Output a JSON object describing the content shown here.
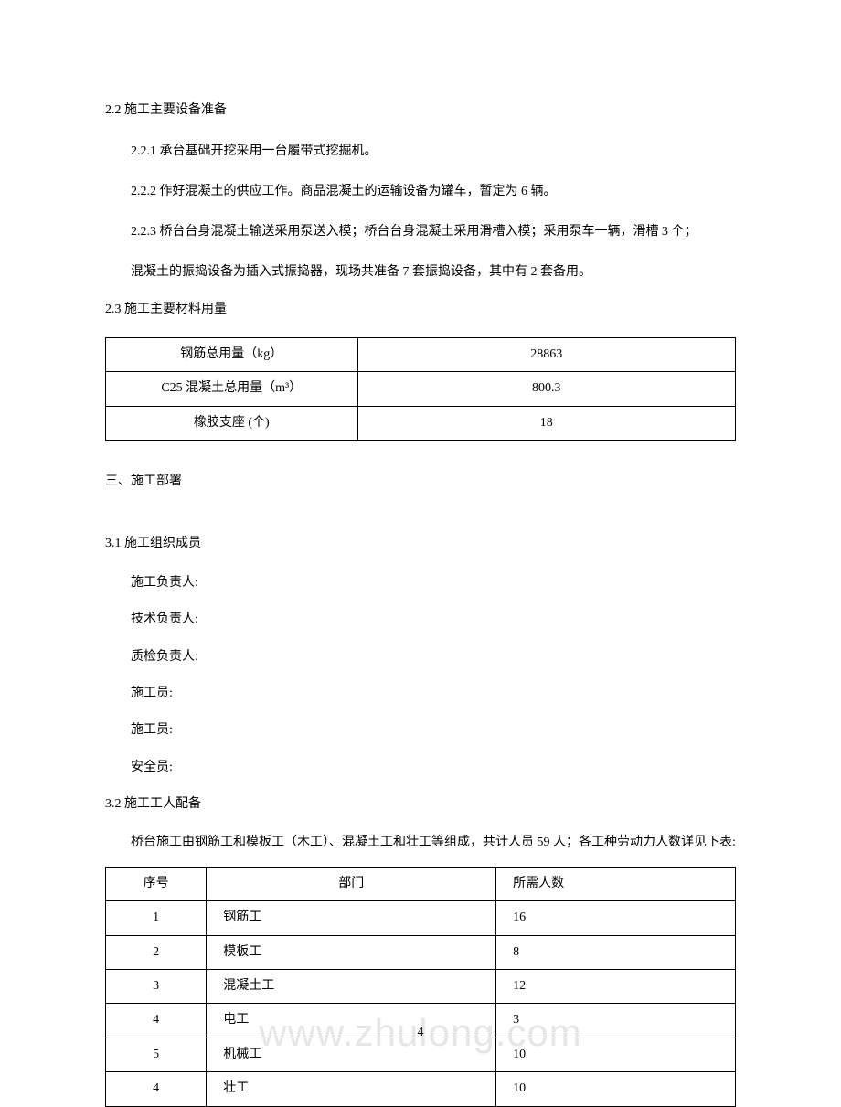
{
  "section22": {
    "heading": "2.2 施工主要设备准备",
    "item1": "2.2.1 承台基础开挖采用一台履带式挖掘机。",
    "item2": "2.2.2 作好混凝土的供应工作。商品混凝土的运输设备为罐车，暂定为 6 辆。",
    "item3": "2.2.3 桥台台身混凝土输送采用泵送入模；桥台台身混凝土采用滑槽入模；采用泵车一辆，滑槽 3 个；",
    "item3b": "混凝土的振捣设备为插入式振捣器，现场共准备 7 套振捣设备，其中有 2 套备用。"
  },
  "section23": {
    "heading": "2.3 施工主要材料用量",
    "rows": [
      {
        "label": "钢筋总用量（kg）",
        "value": "28863"
      },
      {
        "label": "C25 混凝土总用量（m³）",
        "value": "800.3"
      },
      {
        "label": "橡胶支座 (个)",
        "value": "18"
      }
    ]
  },
  "section3": {
    "heading": "三、施工部署"
  },
  "section31": {
    "heading": "3.1 施工组织成员",
    "roles": [
      "施工负责人:",
      "技术负责人:",
      "质检负责人:",
      "施工员:",
      "施工员:",
      "安全员:"
    ]
  },
  "section32": {
    "heading": "3.2 施工工人配备",
    "intro": "桥台施工由钢筋工和模板工（木工）、混凝土工和壮工等组成，共计人员 59 人；各工种劳动力人数详见下表:",
    "headers": {
      "c1": "序号",
      "c2": "部门",
      "c3": "所需人数"
    },
    "rows": [
      {
        "no": "1",
        "dept": "钢筋工",
        "count": "16"
      },
      {
        "no": "2",
        "dept": "模板工",
        "count": "8"
      },
      {
        "no": "3",
        "dept": "混凝土工",
        "count": "12"
      },
      {
        "no": "4",
        "dept": "电工",
        "count": "3"
      },
      {
        "no": "5",
        "dept": "机械工",
        "count": "10"
      },
      {
        "no": "4",
        "dept": "壮工",
        "count": "10"
      }
    ]
  },
  "pageNumber": "4",
  "watermark": "www.zhulong.com"
}
